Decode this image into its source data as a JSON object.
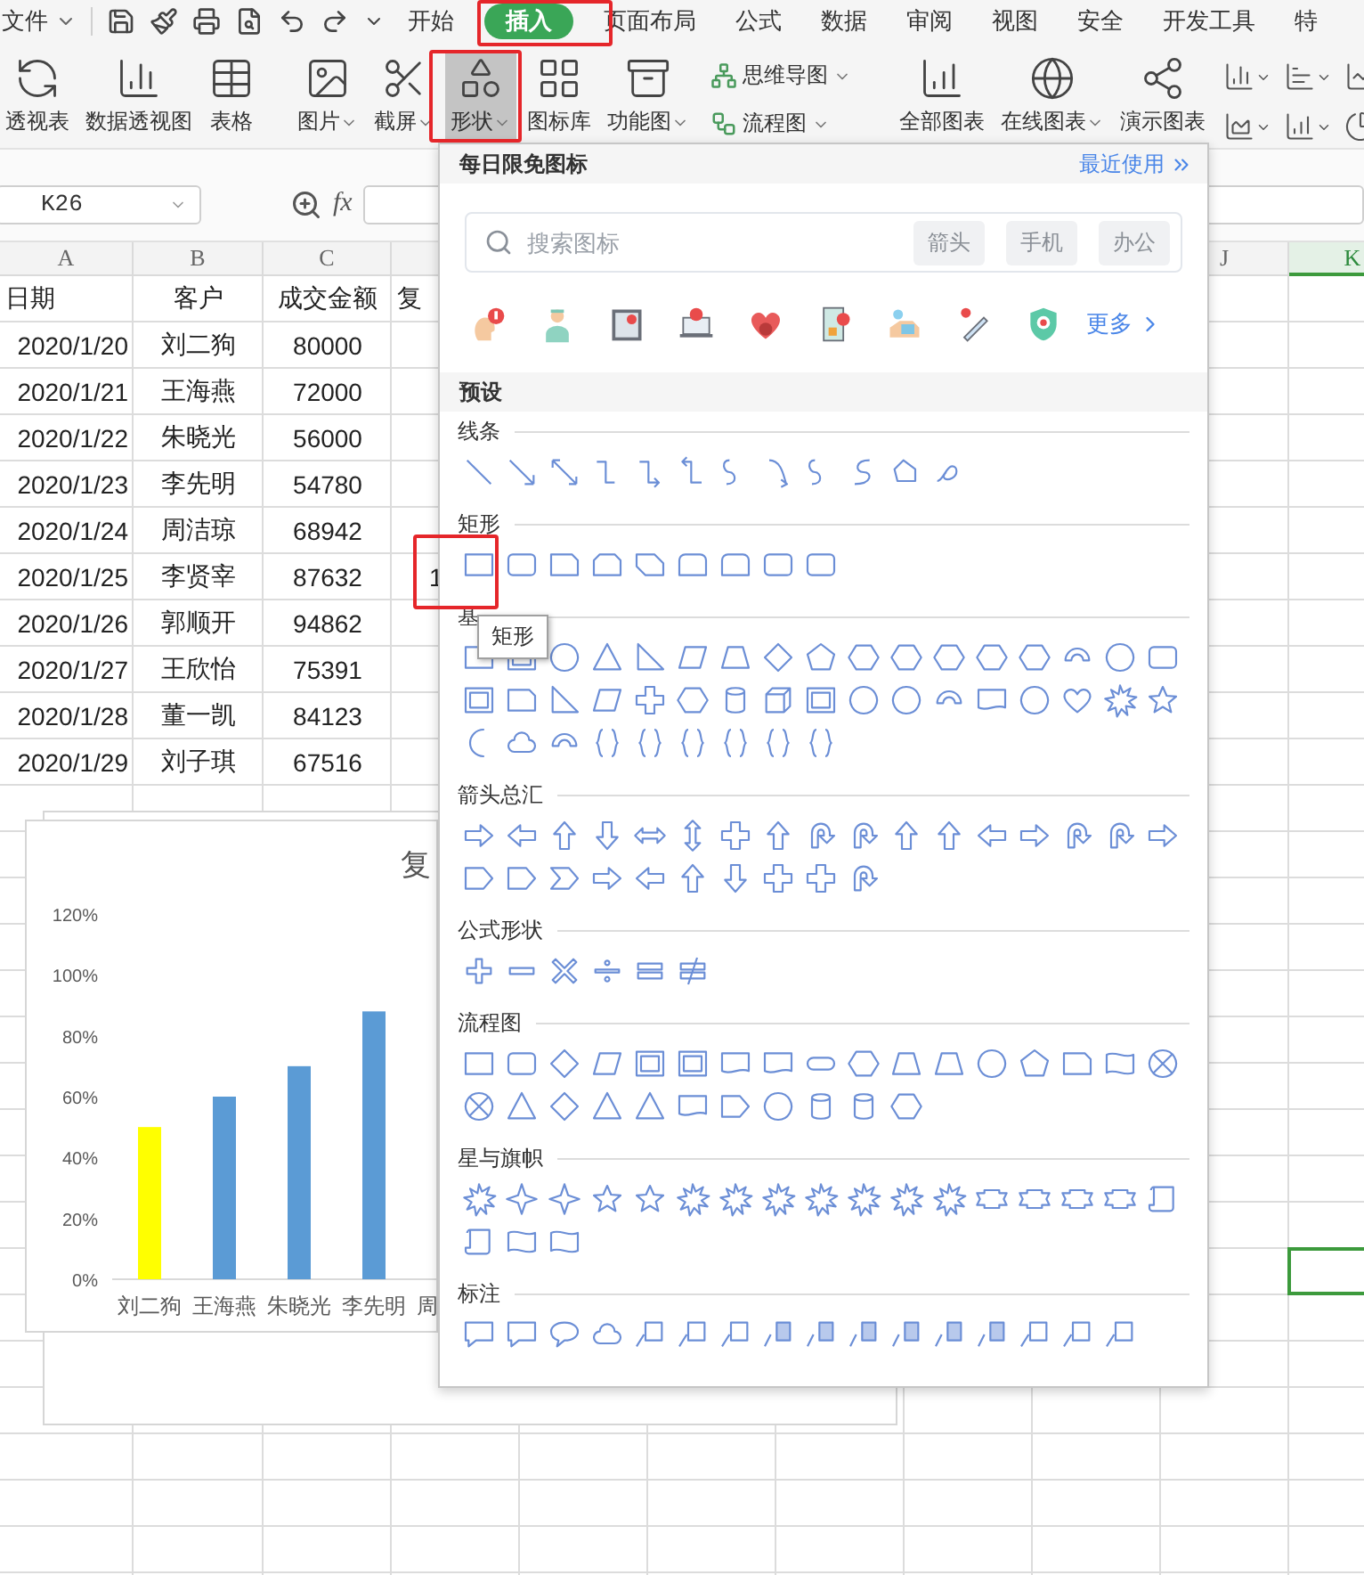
{
  "menu": {
    "file": "文件",
    "tabs": [
      {
        "label": "开始",
        "selected": false
      },
      {
        "label": "插入",
        "selected": true
      },
      {
        "label": "页面布局",
        "selected": false
      },
      {
        "label": "公式",
        "selected": false
      },
      {
        "label": "数据",
        "selected": false
      },
      {
        "label": "审阅",
        "selected": false
      },
      {
        "label": "视图",
        "selected": false
      },
      {
        "label": "安全",
        "selected": false
      },
      {
        "label": "开发工具",
        "selected": false
      },
      {
        "label": "特",
        "selected": false
      }
    ]
  },
  "ribbon": [
    {
      "kind": "large",
      "label": "透视表",
      "dropdown": false,
      "pressed": false
    },
    {
      "kind": "large",
      "label": "数据透视图",
      "dropdown": false,
      "pressed": false
    },
    {
      "kind": "large",
      "label": "表格",
      "dropdown": false,
      "pressed": false
    },
    {
      "kind": "large",
      "label": "图片",
      "dropdown": true,
      "pressed": false
    },
    {
      "kind": "large",
      "label": "截屏",
      "dropdown": true,
      "pressed": false
    },
    {
      "kind": "large",
      "label": "形状",
      "dropdown": true,
      "pressed": true
    },
    {
      "kind": "large",
      "label": "图标库",
      "dropdown": false,
      "pressed": false
    },
    {
      "kind": "large",
      "label": "功能图",
      "dropdown": true,
      "pressed": false
    },
    {
      "kind": "stack",
      "items": [
        {
          "label": "思维导图",
          "dropdown": true
        },
        {
          "label": "流程图",
          "dropdown": true
        }
      ]
    },
    {
      "kind": "large",
      "label": "全部图表",
      "dropdown": false,
      "pressed": false
    },
    {
      "kind": "large",
      "label": "在线图表",
      "dropdown": true,
      "pressed": false
    },
    {
      "kind": "large",
      "label": "演示图表",
      "dropdown": false,
      "pressed": false
    }
  ],
  "formula_bar": {
    "name_box": "K26",
    "function_label": "fx"
  },
  "sheet": {
    "columns": [
      {
        "label": "A",
        "selected": false
      },
      {
        "label": "B",
        "selected": false
      },
      {
        "label": "C",
        "selected": false
      },
      {
        "selected": false
      },
      {
        "label": "J",
        "selected": false
      },
      {
        "label": "K",
        "selected": true
      }
    ],
    "header": {
      "date": "日期",
      "customer": "客户",
      "amount": "成交金额",
      "column_d": "复"
    },
    "rows": [
      {
        "date": "2020/1/20",
        "customer": "刘二狗",
        "amount": "80000"
      },
      {
        "date": "2020/1/21",
        "customer": "王海燕",
        "amount": "72000"
      },
      {
        "date": "2020/1/22",
        "customer": "朱晓光",
        "amount": "56000"
      },
      {
        "date": "2020/1/23",
        "customer": "李先明",
        "amount": "54780"
      },
      {
        "date": "2020/1/24",
        "customer": "周洁琼",
        "amount": "68942"
      },
      {
        "date": "2020/1/25",
        "customer": "李贤宰",
        "amount": "87632",
        "column_d": "1"
      },
      {
        "date": "2020/1/26",
        "customer": "郭顺开",
        "amount": "94862"
      },
      {
        "date": "2020/1/27",
        "customer": "王欣怡",
        "amount": "75391"
      },
      {
        "date": "2020/1/28",
        "customer": "董一凯",
        "amount": "84123"
      },
      {
        "date": "2020/1/29",
        "customer": "刘子琪",
        "amount": "67516"
      }
    ],
    "active_cell_shown": true
  },
  "chart": {
    "chart_data": {
      "type": "bar",
      "title": "复",
      "categories": [
        "刘二狗",
        "王海燕",
        "朱晓光",
        "李先明",
        "周"
      ],
      "series": [
        {
          "color": "#ffff00",
          "values": [
            0.5,
            null,
            null,
            null,
            null
          ]
        },
        {
          "color": "#5b9bd5",
          "values": [
            null,
            0.6,
            0.7,
            0.88,
            null
          ]
        }
      ],
      "stacked": true,
      "ylim": [
        0,
        1.2
      ],
      "yticks": [
        {
          "value": 0,
          "label": "0%"
        },
        {
          "value": 0.2,
          "label": "20%"
        },
        {
          "value": 0.4,
          "label": "40%"
        },
        {
          "value": 0.6,
          "label": "60%"
        },
        {
          "value": 0.8,
          "label": "80%"
        },
        {
          "value": 1,
          "label": "100%"
        },
        {
          "value": 1.2,
          "label": "120%"
        }
      ]
    }
  },
  "shape_panel": {
    "title": "每日限免图标",
    "recent_link": "最近使用",
    "search": {
      "placeholder": "搜索图标",
      "tags": [
        "箭头",
        "手机",
        "办公"
      ]
    },
    "more_link": "更多",
    "preset_label": "预设",
    "sections": [
      {
        "title": "线条"
      },
      {
        "title": "矩形"
      },
      {
        "title": "基"
      },
      {
        "title": "箭头总汇"
      },
      {
        "title": "公式形状"
      },
      {
        "title": "流程图"
      },
      {
        "title": "星与旗帜"
      },
      {
        "title": "标注"
      }
    ]
  },
  "tooltip": {
    "text": "矩形"
  }
}
